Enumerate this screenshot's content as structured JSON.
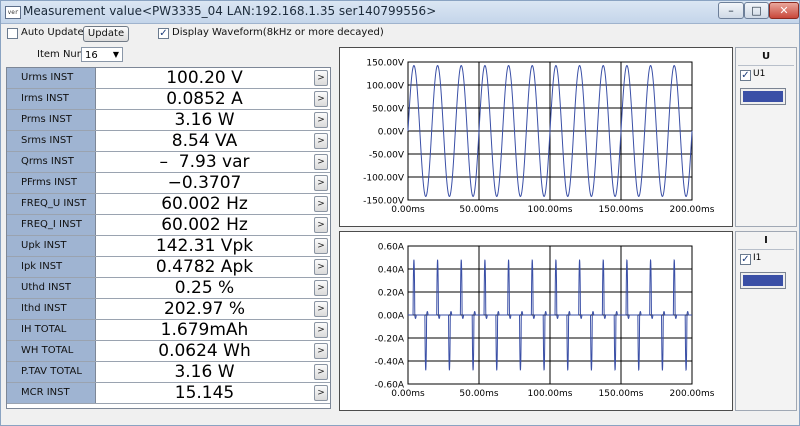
{
  "window": {
    "title": "Measurement value<PW3335_04 LAN:192.168.1.35 ser140799556>",
    "app_icon_label": "ver"
  },
  "toolbar": {
    "auto_update_label": "Auto Update",
    "auto_update_checked": false,
    "update_button_label": "Update",
    "display_waveform_label": "Display Waveform(8kHz or more decayed)",
    "display_waveform_checked": true,
    "item_num_label": "Item Num",
    "item_num_value": "16"
  },
  "measurements": [
    {
      "label": "Urms INST",
      "value": "100.20 V"
    },
    {
      "label": "Irms INST",
      "value": "0.0852 A"
    },
    {
      "label": "Prms INST",
      "value": "3.16 W"
    },
    {
      "label": "Srms INST",
      "value": "8.54 VA"
    },
    {
      "label": "Qrms INST",
      "value": "–  7.93 var"
    },
    {
      "label": "PFrms INST",
      "value": "−0.3707"
    },
    {
      "label": "FREQ_U INST",
      "value": "60.002 Hz"
    },
    {
      "label": "FREQ_I INST",
      "value": "60.002 Hz"
    },
    {
      "label": "Upk INST",
      "value": "142.31 Vpk"
    },
    {
      "label": "Ipk INST",
      "value": "0.4782 Apk"
    },
    {
      "label": "Uthd INST",
      "value": "0.25 %"
    },
    {
      "label": "Ithd INST",
      "value": "202.97 %"
    },
    {
      "label": "IH TOTAL",
      "value": "1.679mAh"
    },
    {
      "label": "WH TOTAL",
      "value": "0.0624 Wh"
    },
    {
      "label": "P.TAV TOTAL",
      "value": "3.16 W"
    },
    {
      "label": "MCR INST",
      "value": "15.145"
    }
  ],
  "row_more_glyph": ">",
  "chart_data": [
    {
      "type": "line",
      "y_ticks": [
        "150.00V",
        "100.00V",
        "50.00V",
        "0.00V",
        "-50.00V",
        "-100.00V",
        "-150.00V"
      ],
      "x_ticks": [
        "0.00ms",
        "50.00ms",
        "100.00ms",
        "150.00ms",
        "200.00ms"
      ],
      "ylim": [
        -150,
        150
      ],
      "xlim": [
        0,
        200
      ],
      "grid": true,
      "series": [
        {
          "name": "U1",
          "waveform": "sine",
          "amplitude": 142.31,
          "frequency_hz": 60.002,
          "color": "#3a4fa6"
        }
      ]
    },
    {
      "type": "line",
      "y_ticks": [
        "0.60A",
        "0.40A",
        "0.20A",
        "0.00A",
        "-0.20A",
        "-0.40A",
        "-0.60A"
      ],
      "x_ticks": [
        "0.00ms",
        "50.00ms",
        "100.00ms",
        "150.00ms",
        "200.00ms"
      ],
      "ylim": [
        -0.6,
        0.6
      ],
      "xlim": [
        0,
        200
      ],
      "grid": true,
      "series": [
        {
          "name": "I1",
          "waveform": "pulse",
          "amplitude": 0.4782,
          "frequency_hz": 60.002,
          "color": "#3a4fa6"
        }
      ]
    }
  ],
  "panels": {
    "voltage": {
      "title": "U",
      "channel_label": "U1",
      "checked": true,
      "color": "#3a4fa6"
    },
    "current": {
      "title": "I",
      "channel_label": "I1",
      "checked": true,
      "color": "#3a4fa6"
    }
  },
  "window_buttons": {
    "minimize": "–",
    "maximize": "□",
    "close": "✕"
  }
}
